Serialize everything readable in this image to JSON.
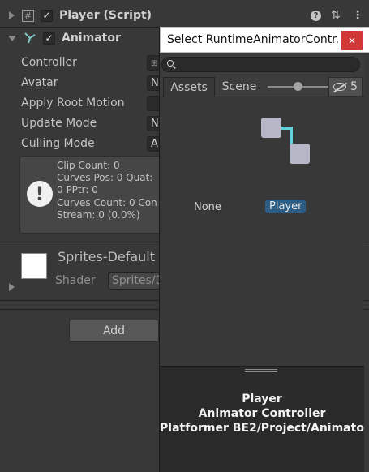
{
  "inspector": {
    "script_component": {
      "title": "Player (Script)",
      "checked": "✓"
    },
    "animator_component": {
      "title": "Animator",
      "checked": "✓",
      "properties": [
        {
          "label": "Controller",
          "value": ""
        },
        {
          "label": "Avatar",
          "value": "N"
        },
        {
          "label": "Apply Root Motion",
          "value": ""
        },
        {
          "label": "Update Mode",
          "value": "N"
        },
        {
          "label": "Culling Mode",
          "value": "A"
        }
      ],
      "info_lines": [
        "Clip Count: 0",
        "Curves Pos: 0 Quat:",
        "0 PPtr: 0",
        "Curves Count: 0 Con",
        "Stream: 0 (0.0%)"
      ]
    },
    "material": {
      "name": "Sprites-Default",
      "shader_label": "Shader",
      "shader_value": "Sprites/D"
    },
    "add_button_label": "Add"
  },
  "picker": {
    "title": "Select RuntimeAnimatorContr...",
    "close_label": "×",
    "search_placeholder": "",
    "tabs": [
      {
        "label": "Assets"
      },
      {
        "label": "Scene"
      }
    ],
    "visible_count": "5",
    "items": [
      {
        "label": "None"
      },
      {
        "label": "Player"
      }
    ],
    "preview": {
      "name": "Player",
      "type": "Animator Controller",
      "path": "Platformer BE2/Project/Animato"
    }
  },
  "colors": {
    "selection": "#2c5d87",
    "close_button": "#d13737",
    "controller_icon_node": "#b6b8c8",
    "controller_icon_link": "#5fd3d8"
  }
}
